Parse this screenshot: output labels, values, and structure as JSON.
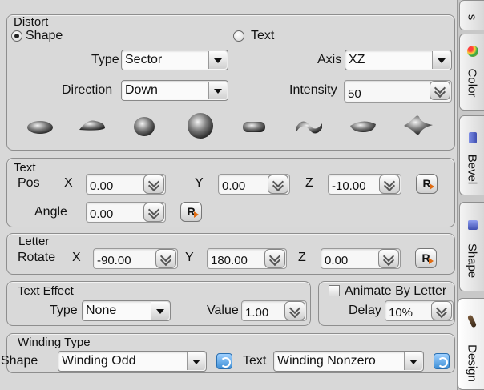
{
  "distort": {
    "group_label": "Distort",
    "shape_radio": "Shape",
    "text_radio": "Text",
    "type_label": "Type",
    "type_value": "Sector",
    "axis_label": "Axis",
    "axis_value": "XZ",
    "direction_label": "Direction",
    "direction_value": "Down",
    "intensity_label": "Intensity",
    "intensity_value": "50",
    "presets": [
      "flat-ellipse",
      "dome",
      "sphere-small",
      "sphere-large",
      "capsule",
      "wave",
      "lens",
      "star-burst"
    ]
  },
  "text": {
    "group_label": "Text",
    "pos_label": "Pos",
    "x_label": "X",
    "x_value": "0.00",
    "y_label": "Y",
    "y_value": "0.00",
    "z_label": "Z",
    "z_value": "-10.00",
    "angle_label": "Angle",
    "angle_value": "0.00",
    "reset_label": "R"
  },
  "letter": {
    "group_label": "Letter",
    "rotate_label": "Rotate",
    "x_label": "X",
    "x_value": "-90.00",
    "y_label": "Y",
    "y_value": "180.00",
    "z_label": "Z",
    "z_value": "0.00",
    "reset_label": "R"
  },
  "text_effect": {
    "group_label": "Text Effect",
    "type_label": "Type",
    "type_value": "None",
    "value_label": "Value",
    "value_value": "1.00"
  },
  "animate": {
    "checkbox_label": "Animate By Letter",
    "delay_label": "Delay",
    "delay_value": "10%"
  },
  "winding": {
    "group_label": "Winding Type",
    "shape_label": "Shape",
    "shape_value": "Winding Odd",
    "text_label": "Text",
    "text_value": "Winding Nonzero"
  },
  "tabs": {
    "tab_top": "s",
    "color": "Color",
    "bevel": "Bevel",
    "shape": "Shape",
    "design": "Design"
  },
  "colors": {
    "panel_bg": "#d8d8d8",
    "accent_orange": "#e06a10",
    "refresh_blue": "#3e8fd6"
  }
}
